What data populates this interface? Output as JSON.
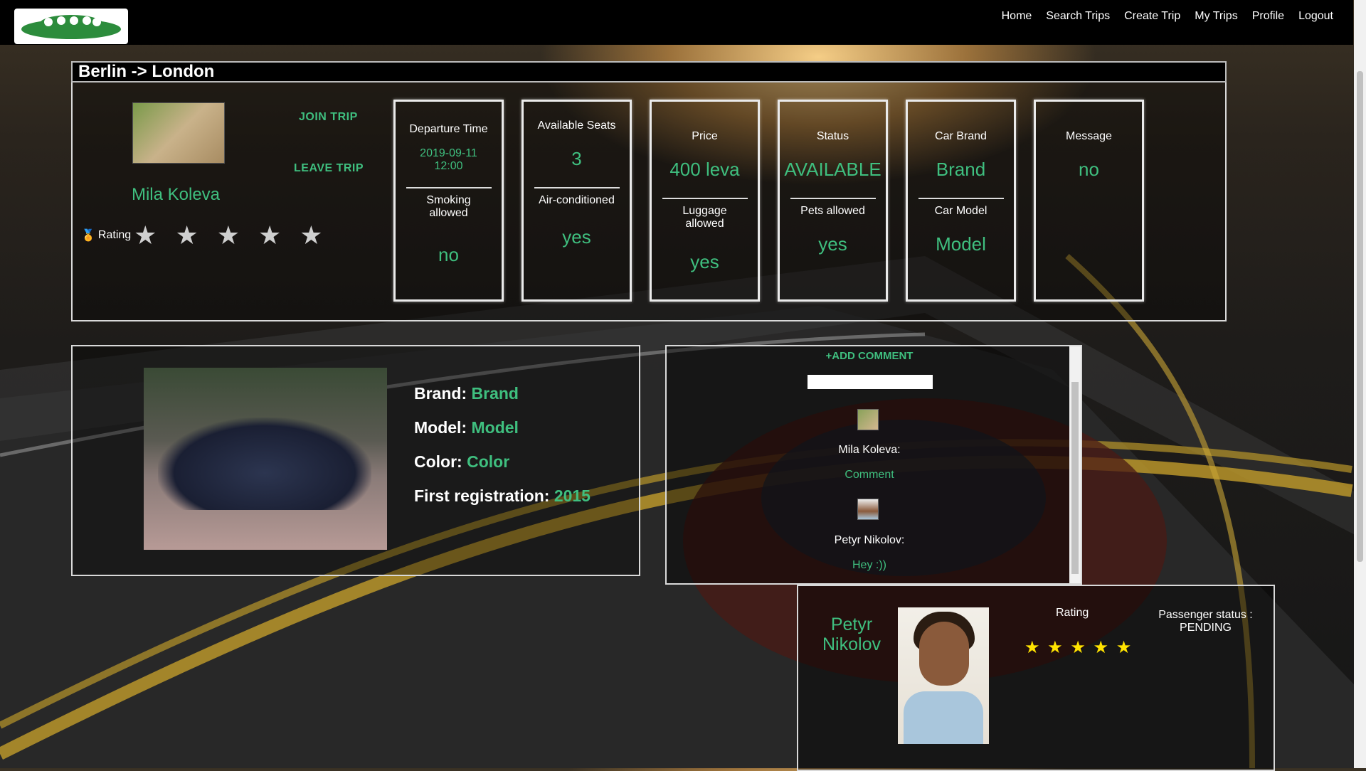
{
  "nav": {
    "links": [
      "Home",
      "Search Trips",
      "Create Trip",
      "My Trips",
      "Profile",
      "Logout"
    ]
  },
  "trip": {
    "title": "Berlin -> London",
    "join_label": "JOIN TRIP",
    "leave_label": "LEAVE TRIP",
    "driver": {
      "name": "Mila Koleva",
      "rating_label": "Rating",
      "stars": "★ ★ ★ ★ ★"
    },
    "boxes": [
      {
        "label": "Departure Time",
        "value": "2019-09-11 12:00",
        "label2": "Smoking allowed",
        "value2": "no"
      },
      {
        "label": "Available Seats",
        "value": "3",
        "label2": "Air-conditioned",
        "value2": "yes"
      },
      {
        "label": "Price",
        "value": "400 leva",
        "label2": "Luggage allowed",
        "value2": "yes"
      },
      {
        "label": "Status",
        "value": "AVAILABLE",
        "label2": "Pets allowed",
        "value2": "yes"
      },
      {
        "label": "Car Brand",
        "value": "Brand",
        "label2": "Car Model",
        "value2": "Model"
      },
      {
        "label": "Message",
        "value": "no"
      }
    ]
  },
  "car": {
    "brand_label": "Brand:",
    "brand": "Brand",
    "model_label": "Model:",
    "model": "Model",
    "color_label": "Color:",
    "color": "Color",
    "reg_label": "First registration:",
    "reg": "2015"
  },
  "comments": {
    "add_label": "+ADD COMMENT",
    "input_value": "",
    "items": [
      {
        "author": "Mila Koleva:",
        "text": "Comment"
      },
      {
        "author": "Petyr Nikolov:",
        "text": "Hey :))"
      }
    ]
  },
  "passenger": {
    "name": "Petyr Nikolov",
    "rating_label": "Rating",
    "stars": "★ ★ ★ ★ ★",
    "status": "Passenger status : PENDING"
  },
  "colors": {
    "accent": "#3fbf7f",
    "star": "#ffe300"
  }
}
